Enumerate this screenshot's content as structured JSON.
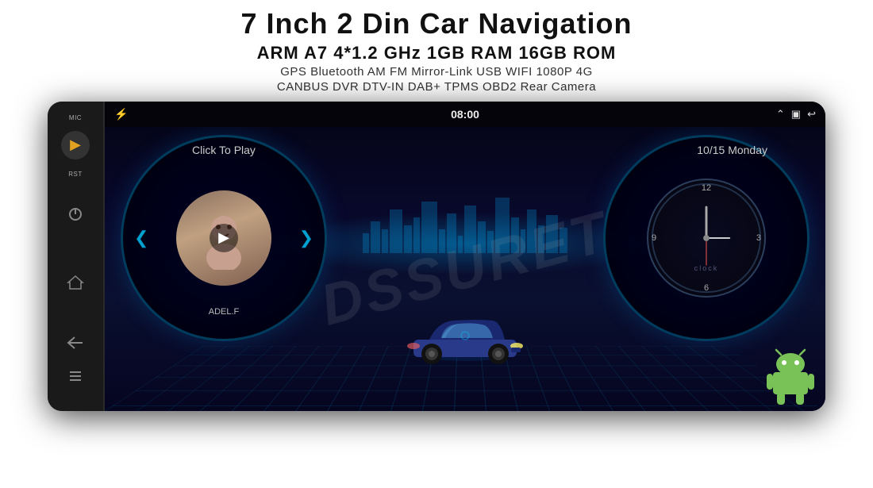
{
  "header": {
    "title": "7 Inch 2 Din Car Navigation",
    "specs": "ARM A7 4*1.2 GHz    1GB RAM    16GB ROM",
    "features_row1": "GPS  Bluetooth  AM  FM  Mirror-Link  USB  WIFI  1080P  4G",
    "features_row2": "CANBUS  DVR  DTV-IN  DAB+  TPMS  OBD2  Rear Camera"
  },
  "device": {
    "side_panel": {
      "mic_label": "MIC",
      "rst_label": "RST"
    },
    "status_bar": {
      "time": "08:00",
      "bt_icon": "bluetooth"
    },
    "screen": {
      "click_to_play": "Click To Play",
      "date": "10/15 Monday",
      "track_name": "ADEL.F",
      "clock_label": "clock"
    },
    "watermark": "DSSURET"
  },
  "colors": {
    "accent": "#00c8ff",
    "bg_dark": "#05051a",
    "side_panel": "#1a1a1a"
  }
}
